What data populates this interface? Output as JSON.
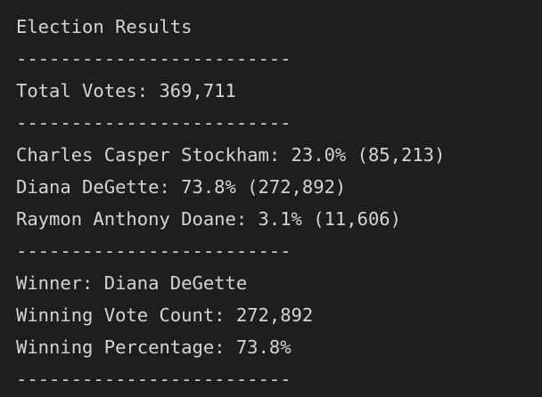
{
  "output": {
    "title": "Election Results",
    "sep1": "-------------------------",
    "total_votes": "Total Votes: 369,711",
    "sep2": "-------------------------",
    "candidates": [
      "Charles Casper Stockham: 23.0% (85,213)",
      "Diana DeGette: 73.8% (272,892)",
      "Raymon Anthony Doane: 3.1% (11,606)"
    ],
    "sep3": "-------------------------",
    "winner": "Winner: Diana DeGette",
    "winning_count": "Winning Vote Count: 272,892",
    "winning_percentage": "Winning Percentage: 73.8%",
    "sep4": "-------------------------"
  }
}
